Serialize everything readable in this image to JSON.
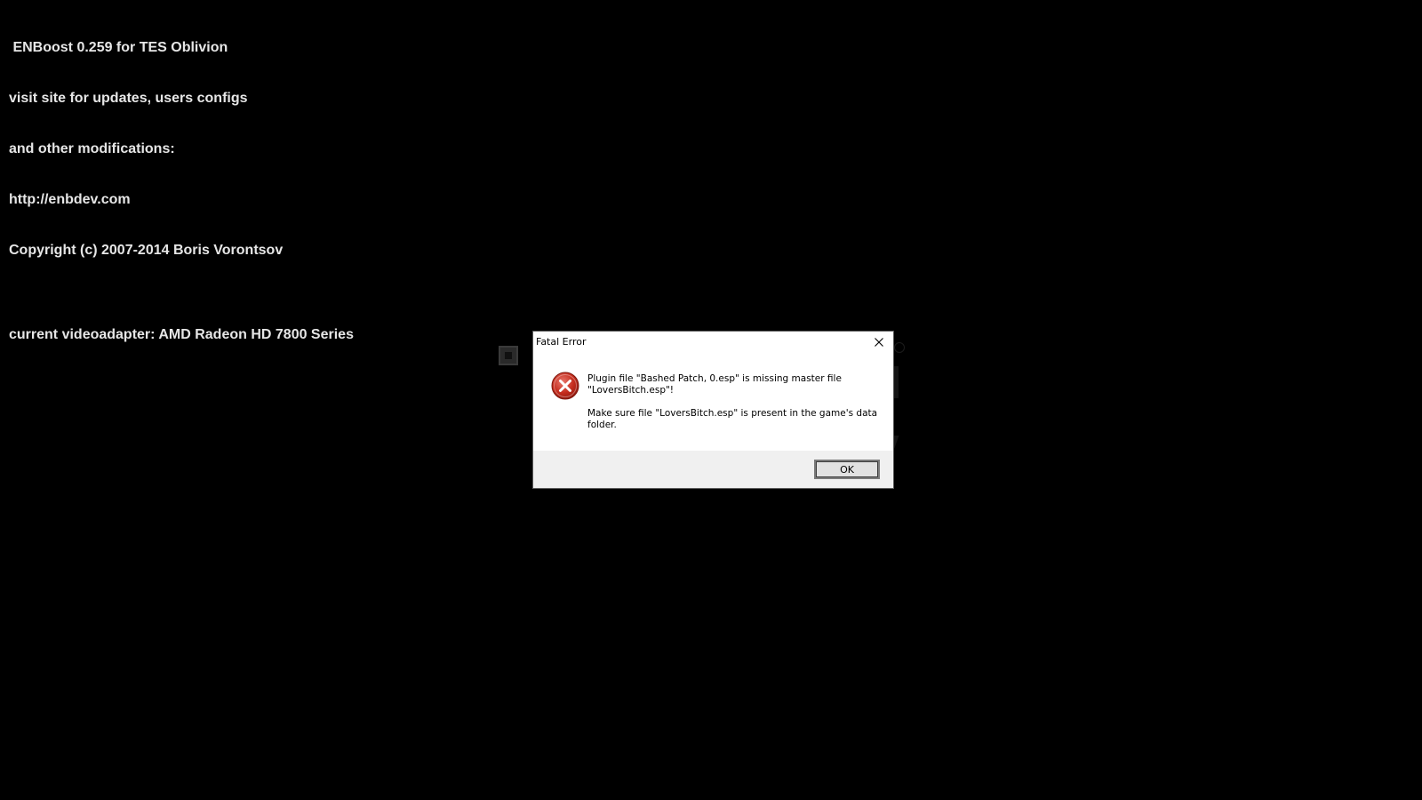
{
  "overlay": {
    "lines": [
      " ENBoost 0.259 for TES Oblivion",
      "visit site for updates, users configs",
      "and other modifications:",
      "http://enbdev.com",
      "Copyright (c) 2007-2014 Boris Vorontsov"
    ],
    "adapter": "current videoadapter: AMD Radeon HD 7800 Series",
    "color": "#e6e6e6"
  },
  "dialog": {
    "title": "Fatal Error",
    "close_icon": "close-icon",
    "error_icon": "error-icon",
    "message_line1": "Plugin file \"Bashed Patch, 0.esp\" is missing master file \"LoversBitch.esp\"!",
    "message_line2": "Make sure file \"LoversBitch.esp\" is present in the game's data folder.",
    "ok_label": "OK",
    "error_color": "#c42b1c",
    "footer_color": "#f0f0f0"
  }
}
